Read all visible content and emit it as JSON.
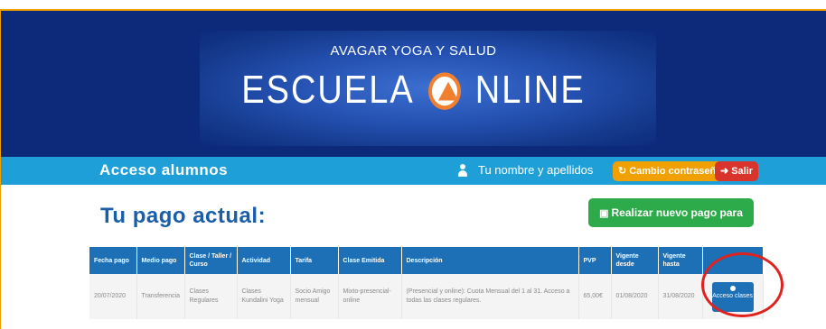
{
  "banner": {
    "subtitle": "AVAGAR YOGA Y SALUD",
    "title_left": "ESCUELA",
    "title_right": "NLINE",
    "logo_icon": "avagar-logo-icon"
  },
  "nav": {
    "title": "Acceso alumnos",
    "user_icon": "user-icon",
    "user_name": "Tu nombre y apellidos",
    "change_password_icon": "refresh-icon",
    "change_password": "Cambio contraseña",
    "exit_icon": "sign-out-icon",
    "exit": "Salir"
  },
  "main": {
    "title": "Tu pago actual:",
    "new_payment_icon": "money-icon",
    "new_payment": "Realizar nuevo pago para clases"
  },
  "table": {
    "headers": [
      "Fecha pago",
      "Medio pago",
      "Clase / Taller / Curso",
      "Actividad",
      "Tarifa",
      "Clase Emitida",
      "Descripción",
      "PVP",
      "Vigente desde",
      "Vigente hasta",
      ""
    ],
    "row": {
      "fecha": "20/07/2020",
      "medio": "Transferencia",
      "clase": "Clases Regulares",
      "actividad": "Clases Kundalini Yoga",
      "tarifa": "Socio Amigo mensual",
      "emitida": "Mixto-presencial-online",
      "descripcion": "(Presencial y online): Cuota Mensual del 1 al 31. Acceso a todas las clases regulares.",
      "pvp": "65,00€",
      "desde": "01/08/2020",
      "hasta": "31/08/2020",
      "acceso": "Acceso clases"
    }
  },
  "colors": {
    "banner_bg": "#0d2a7a",
    "nav_bg": "#1e9fd8",
    "title_blue": "#1a5ea8",
    "orange": "#f0a000",
    "red": "#d9342b",
    "green": "#2daa4a",
    "table_header": "#1d6fb6",
    "highlight_circle": "#e0221e"
  }
}
